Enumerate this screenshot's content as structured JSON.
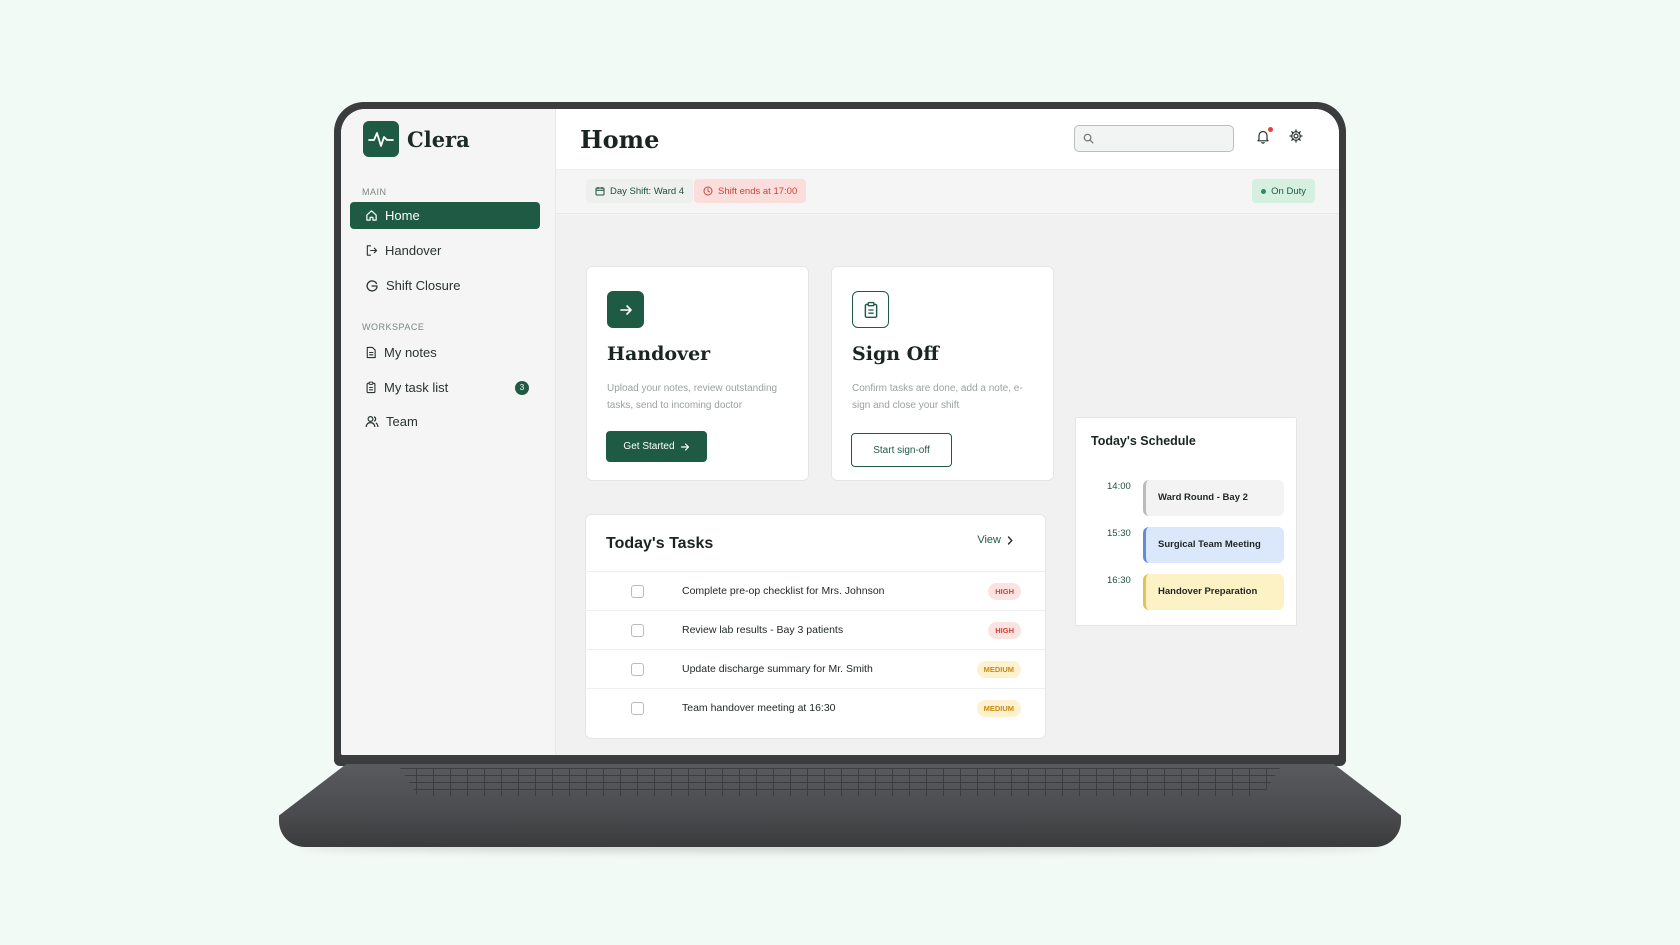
{
  "app": {
    "name": "Clera"
  },
  "sidebar": {
    "main_label": "MAIN",
    "workspace_label": "WORKSPACE",
    "main_items": [
      {
        "label": "Home",
        "icon": "home-icon",
        "active": true
      },
      {
        "label": "Handover",
        "icon": "log-out-icon"
      },
      {
        "label": "Shift Closure",
        "icon": "refresh-icon"
      }
    ],
    "workspace_items": [
      {
        "label": "My notes",
        "icon": "note-icon"
      },
      {
        "label": "My task list",
        "icon": "clipboard-icon",
        "badge": "3"
      },
      {
        "label": "Team",
        "icon": "users-icon"
      }
    ]
  },
  "header": {
    "title": "Home",
    "search_placeholder": ""
  },
  "infobar": {
    "shift": "Day Shift: Ward 4",
    "shift_ends": "Shift ends at 17:00",
    "status": "On Duty"
  },
  "cards": {
    "handover": {
      "title": "Handover",
      "description": "Upload your notes, review outstanding tasks, send to incoming doctor",
      "button": "Get Started"
    },
    "signoff": {
      "title": "Sign Off",
      "description": "Confirm tasks are done, add a note, e-sign and close your shift",
      "button": "Start sign-off"
    }
  },
  "tasks": {
    "title": "Today's Tasks",
    "view_label": "View",
    "items": [
      {
        "text": "Complete pre-op checklist for Mrs. Johnson",
        "priority": "HIGH"
      },
      {
        "text": "Review lab results - Bay 3 patients",
        "priority": "HIGH"
      },
      {
        "text": "Update discharge summary for Mr. Smith",
        "priority": "MEDIUM"
      },
      {
        "text": "Team handover meeting at 16:30",
        "priority": "MEDIUM"
      }
    ]
  },
  "schedule": {
    "title": "Today's Schedule",
    "events": [
      {
        "time": "14:00",
        "title": "Ward Round - Bay 2"
      },
      {
        "time": "15:30",
        "title": "Surgical Team Meeting"
      },
      {
        "time": "16:30",
        "title": "Handover Preparation"
      }
    ]
  },
  "colors": {
    "brand": "#1f5a44",
    "high": "#d0443a",
    "medium": "#c88a12",
    "background": "#f1faf5"
  }
}
